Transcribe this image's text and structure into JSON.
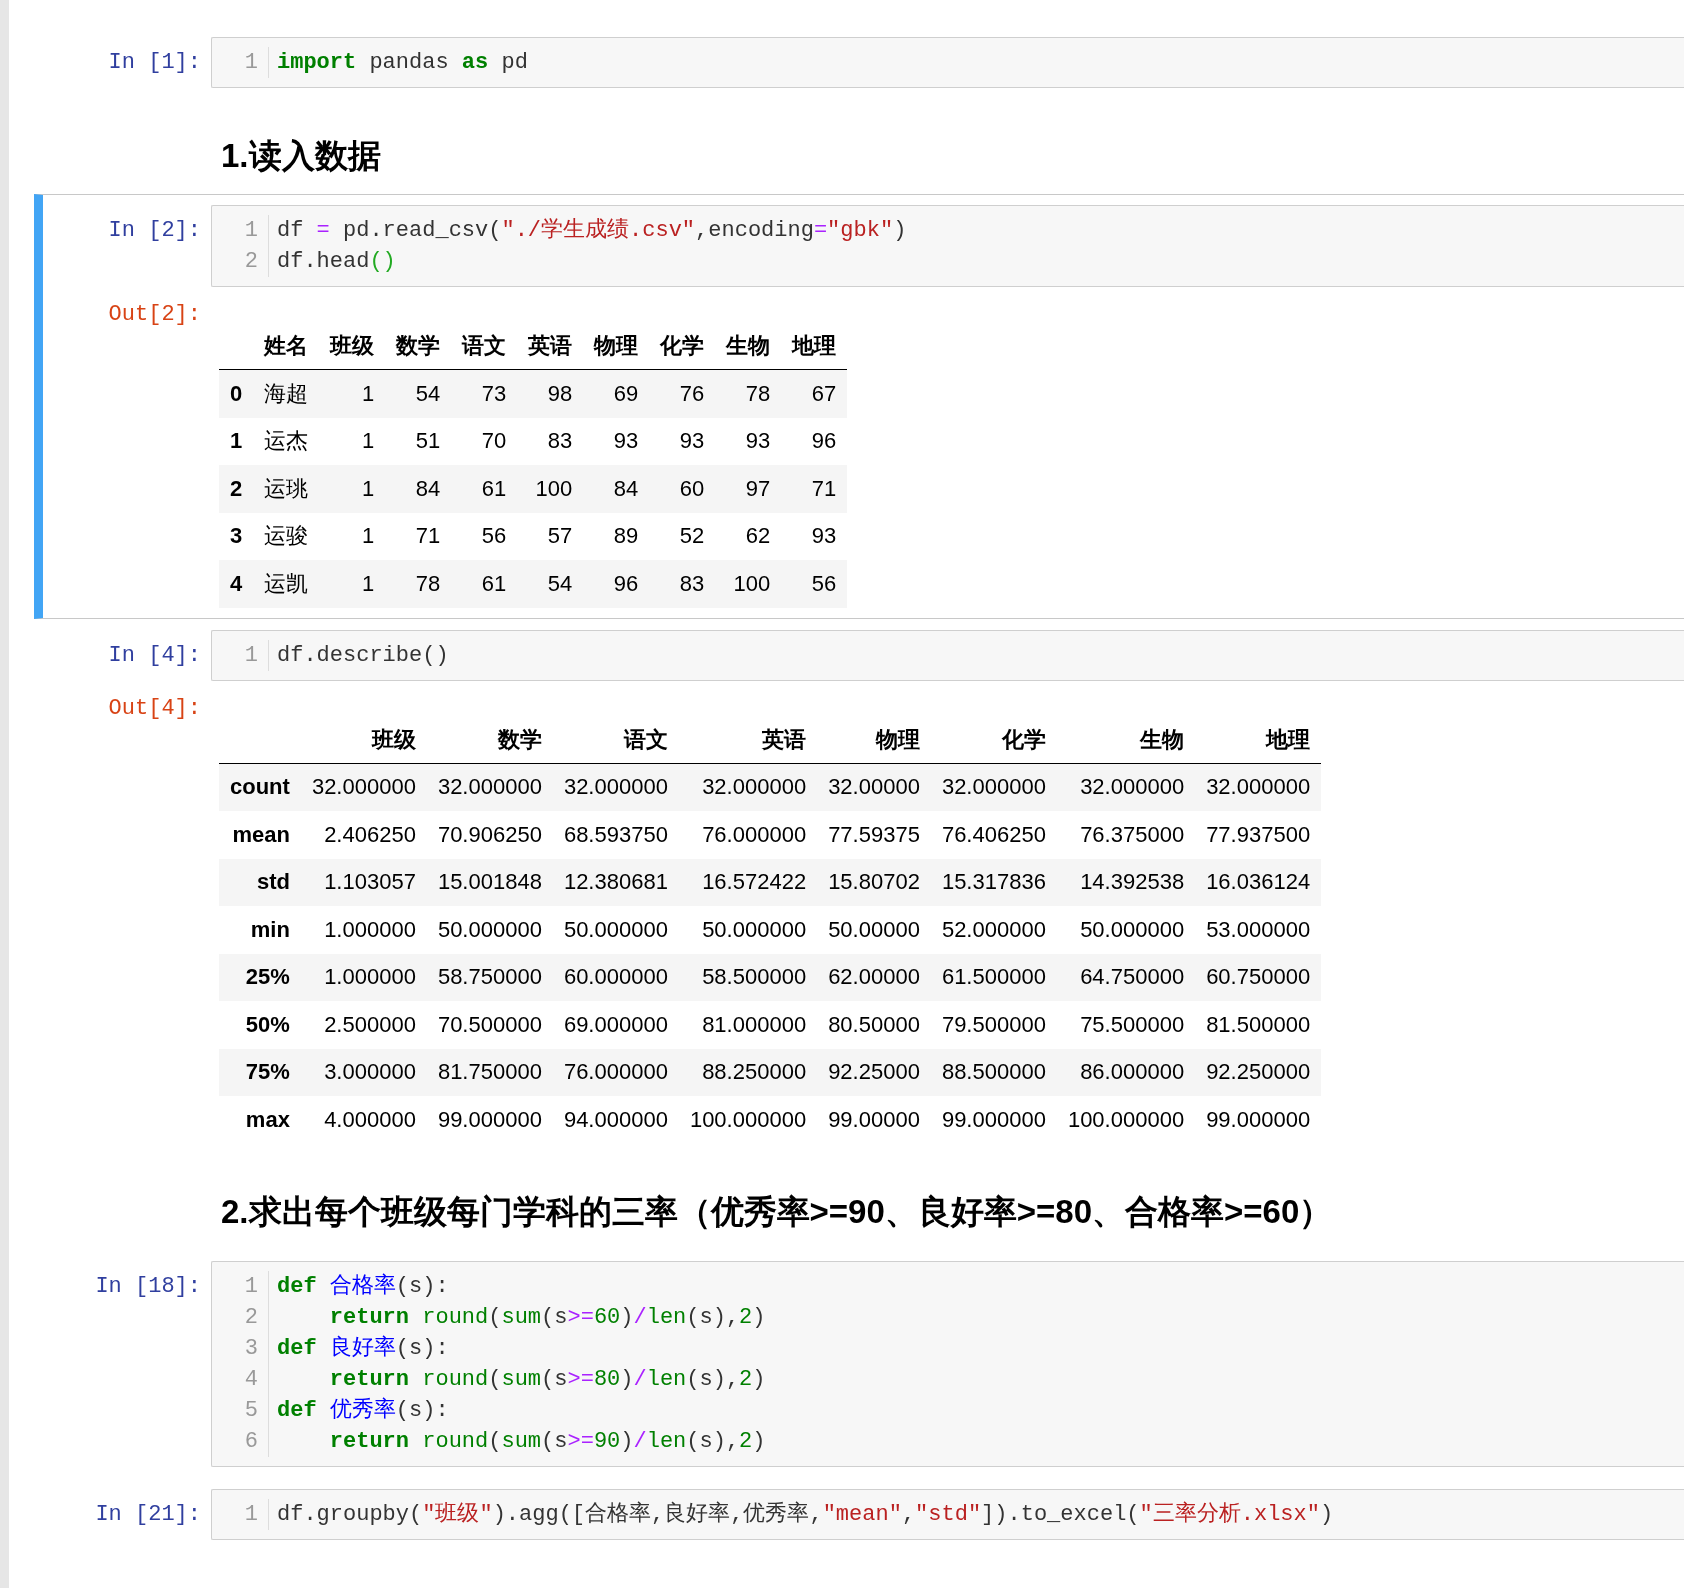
{
  "cells": [
    {
      "kind": "code",
      "selected": false,
      "prompt": "In [1]:",
      "lines": [
        {
          "number": "1",
          "tokens": [
            {
              "kind": "kw",
              "text": "import"
            },
            {
              "kind": "plain",
              "text": " pandas "
            },
            {
              "kind": "kw",
              "text": "as"
            },
            {
              "kind": "plain",
              "text": " pd"
            }
          ]
        }
      ]
    },
    {
      "kind": "markdown",
      "selected": false,
      "text": "1.读入数据"
    },
    {
      "kind": "code",
      "selected": true,
      "prompt": "In [2]:",
      "lines": [
        {
          "number": "1",
          "tokens": [
            {
              "kind": "plain",
              "text": "df "
            },
            {
              "kind": "op",
              "text": "="
            },
            {
              "kind": "plain",
              "text": " pd.read_csv("
            },
            {
              "kind": "str",
              "text": "\"./学生成绩.csv\""
            },
            {
              "kind": "plain",
              "text": ",encoding"
            },
            {
              "kind": "op",
              "text": "="
            },
            {
              "kind": "str",
              "text": "\"gbk\""
            },
            {
              "kind": "plain",
              "text": ")"
            }
          ]
        },
        {
          "number": "2",
          "tokens": [
            {
              "kind": "plain",
              "text": "df.head"
            },
            {
              "kind": "match",
              "text": "()"
            }
          ]
        }
      ],
      "output": {
        "prompt": "Out[2]:",
        "table": {
          "columns": [
            "",
            "姓名",
            "班级",
            "数学",
            "语文",
            "英语",
            "物理",
            "化学",
            "生物",
            "地理"
          ],
          "rows": [
            [
              "0",
              "海超",
              "1",
              "54",
              "73",
              "98",
              "69",
              "76",
              "78",
              "67"
            ],
            [
              "1",
              "运杰",
              "1",
              "51",
              "70",
              "83",
              "93",
              "93",
              "93",
              "96"
            ],
            [
              "2",
              "运珧",
              "1",
              "84",
              "61",
              "100",
              "84",
              "60",
              "97",
              "71"
            ],
            [
              "3",
              "运骏",
              "1",
              "71",
              "56",
              "57",
              "89",
              "52",
              "62",
              "93"
            ],
            [
              "4",
              "运凯",
              "1",
              "78",
              "61",
              "54",
              "96",
              "83",
              "100",
              "56"
            ]
          ]
        }
      }
    },
    {
      "kind": "code",
      "selected": false,
      "prompt": "In [4]:",
      "lines": [
        {
          "number": "1",
          "tokens": [
            {
              "kind": "plain",
              "text": "df.describe()"
            }
          ]
        }
      ],
      "output": {
        "prompt": "Out[4]:",
        "table": {
          "columns": [
            "",
            "班级",
            "数学",
            "语文",
            "英语",
            "物理",
            "化学",
            "生物",
            "地理"
          ],
          "rows": [
            [
              "count",
              "32.000000",
              "32.000000",
              "32.000000",
              "32.000000",
              "32.00000",
              "32.000000",
              "32.000000",
              "32.000000"
            ],
            [
              "mean",
              "2.406250",
              "70.906250",
              "68.593750",
              "76.000000",
              "77.59375",
              "76.406250",
              "76.375000",
              "77.937500"
            ],
            [
              "std",
              "1.103057",
              "15.001848",
              "12.380681",
              "16.572422",
              "15.80702",
              "15.317836",
              "14.392538",
              "16.036124"
            ],
            [
              "min",
              "1.000000",
              "50.000000",
              "50.000000",
              "50.000000",
              "50.00000",
              "52.000000",
              "50.000000",
              "53.000000"
            ],
            [
              "25%",
              "1.000000",
              "58.750000",
              "60.000000",
              "58.500000",
              "62.00000",
              "61.500000",
              "64.750000",
              "60.750000"
            ],
            [
              "50%",
              "2.500000",
              "70.500000",
              "69.000000",
              "81.000000",
              "80.50000",
              "79.500000",
              "75.500000",
              "81.500000"
            ],
            [
              "75%",
              "3.000000",
              "81.750000",
              "76.000000",
              "88.250000",
              "92.25000",
              "88.500000",
              "86.000000",
              "92.250000"
            ],
            [
              "max",
              "4.000000",
              "99.000000",
              "94.000000",
              "100.000000",
              "99.00000",
              "99.000000",
              "100.000000",
              "99.000000"
            ]
          ]
        }
      }
    },
    {
      "kind": "markdown",
      "selected": false,
      "text": "2.求出每个班级每门学科的三率（优秀率>=90、良好率>=80、合格率>=60）"
    },
    {
      "kind": "code",
      "selected": false,
      "prompt": "In [18]:",
      "lines": [
        {
          "number": "1",
          "tokens": [
            {
              "kind": "kw",
              "text": "def"
            },
            {
              "kind": "def",
              "text": " 合格率"
            },
            {
              "kind": "plain",
              "text": "(s):"
            }
          ]
        },
        {
          "number": "2",
          "tokens": [
            {
              "kind": "kw",
              "text": "    return"
            },
            {
              "kind": "builtin",
              "text": " round"
            },
            {
              "kind": "plain",
              "text": "("
            },
            {
              "kind": "builtin",
              "text": "sum"
            },
            {
              "kind": "plain",
              "text": "(s"
            },
            {
              "kind": "op",
              "text": ">="
            },
            {
              "kind": "num",
              "text": "60"
            },
            {
              "kind": "plain",
              "text": ")"
            },
            {
              "kind": "op",
              "text": "/"
            },
            {
              "kind": "builtin",
              "text": "len"
            },
            {
              "kind": "plain",
              "text": "(s),"
            },
            {
              "kind": "num",
              "text": "2"
            },
            {
              "kind": "plain",
              "text": ")"
            }
          ]
        },
        {
          "number": "3",
          "tokens": [
            {
              "kind": "kw",
              "text": "def"
            },
            {
              "kind": "def",
              "text": " 良好率"
            },
            {
              "kind": "plain",
              "text": "(s):"
            }
          ]
        },
        {
          "number": "4",
          "tokens": [
            {
              "kind": "kw",
              "text": "    return"
            },
            {
              "kind": "builtin",
              "text": " round"
            },
            {
              "kind": "plain",
              "text": "("
            },
            {
              "kind": "builtin",
              "text": "sum"
            },
            {
              "kind": "plain",
              "text": "(s"
            },
            {
              "kind": "op",
              "text": ">="
            },
            {
              "kind": "num",
              "text": "80"
            },
            {
              "kind": "plain",
              "text": ")"
            },
            {
              "kind": "op",
              "text": "/"
            },
            {
              "kind": "builtin",
              "text": "len"
            },
            {
              "kind": "plain",
              "text": "(s),"
            },
            {
              "kind": "num",
              "text": "2"
            },
            {
              "kind": "plain",
              "text": ")"
            }
          ]
        },
        {
          "number": "5",
          "tokens": [
            {
              "kind": "kw",
              "text": "def"
            },
            {
              "kind": "def",
              "text": " 优秀率"
            },
            {
              "kind": "plain",
              "text": "(s):"
            }
          ]
        },
        {
          "number": "6",
          "tokens": [
            {
              "kind": "kw",
              "text": "    return"
            },
            {
              "kind": "builtin",
              "text": " round"
            },
            {
              "kind": "plain",
              "text": "("
            },
            {
              "kind": "builtin",
              "text": "sum"
            },
            {
              "kind": "plain",
              "text": "(s"
            },
            {
              "kind": "op",
              "text": ">="
            },
            {
              "kind": "num",
              "text": "90"
            },
            {
              "kind": "plain",
              "text": ")"
            },
            {
              "kind": "op",
              "text": "/"
            },
            {
              "kind": "builtin",
              "text": "len"
            },
            {
              "kind": "plain",
              "text": "(s),"
            },
            {
              "kind": "num",
              "text": "2"
            },
            {
              "kind": "plain",
              "text": ")"
            }
          ]
        }
      ]
    },
    {
      "kind": "code",
      "selected": false,
      "prompt": "In [21]:",
      "lines": [
        {
          "number": "1",
          "tokens": [
            {
              "kind": "plain",
              "text": "df.groupby("
            },
            {
              "kind": "str",
              "text": "\"班级\""
            },
            {
              "kind": "plain",
              "text": ").agg([合格率,良好率,优秀率,"
            },
            {
              "kind": "str",
              "text": "\"mean\""
            },
            {
              "kind": "plain",
              "text": ","
            },
            {
              "kind": "str",
              "text": "\"std\""
            },
            {
              "kind": "plain",
              "text": "]).to_excel("
            },
            {
              "kind": "str",
              "text": "\"三率分析.xlsx\""
            },
            {
              "kind": "plain",
              "text": ")"
            }
          ]
        }
      ]
    }
  ]
}
